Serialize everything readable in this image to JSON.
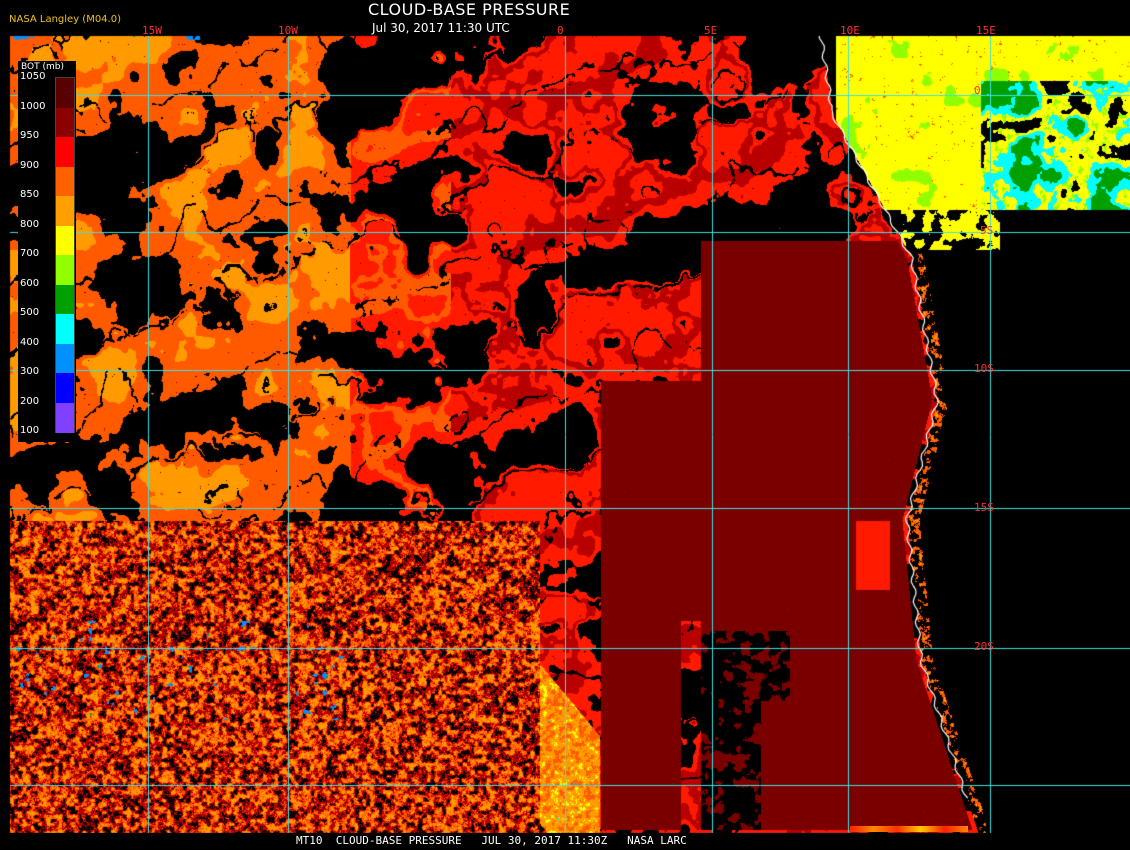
{
  "title": "CLOUD-BASE PRESSURE",
  "subtitle": "Jul 30, 2017 11:30 UTC",
  "credit": "NASA Langley (M04.0)",
  "legend": {
    "title": "BOT (mb)",
    "levels": [
      "1050",
      "1000",
      "950",
      "900",
      "850",
      "800",
      "700",
      "600",
      "500",
      "400",
      "300",
      "200",
      "100"
    ],
    "colors": [
      "#5a0000",
      "#8b0000",
      "#ff0000",
      "#ff6000",
      "#ffa000",
      "#ffff00",
      "#90ff00",
      "#00a000",
      "#00ffff",
      "#0090ff",
      "#0000ff",
      "#8040ff"
    ]
  },
  "lon_labels": [
    "15W",
    "10W",
    "0",
    "5E",
    "10E",
    "15E"
  ],
  "lat_labels": [
    "0",
    "5S",
    "10S",
    "15S",
    "20S"
  ],
  "footer": "MT10  CLOUD-BASE PRESSURE   JUL 30, 2017 11:30Z   NASA LARC",
  "grid_color": "#40e0e0",
  "coast_color": "#ffffff"
}
